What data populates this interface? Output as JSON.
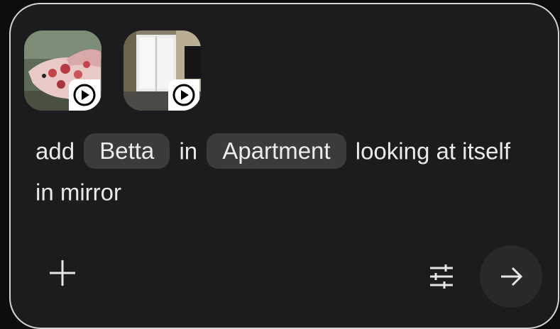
{
  "attachments": [
    {
      "label": "Betta",
      "icon": "play-icon"
    },
    {
      "label": "Apartment",
      "icon": "play-icon"
    }
  ],
  "prompt": {
    "w1": "add",
    "chip1": "Betta",
    "w2": "in",
    "chip2": "Apartment",
    "w3": "looking at itself in mirror"
  },
  "toolbar": {
    "add_icon": "plus-icon",
    "settings_icon": "tune-icon",
    "send_icon": "arrow-right-icon"
  }
}
